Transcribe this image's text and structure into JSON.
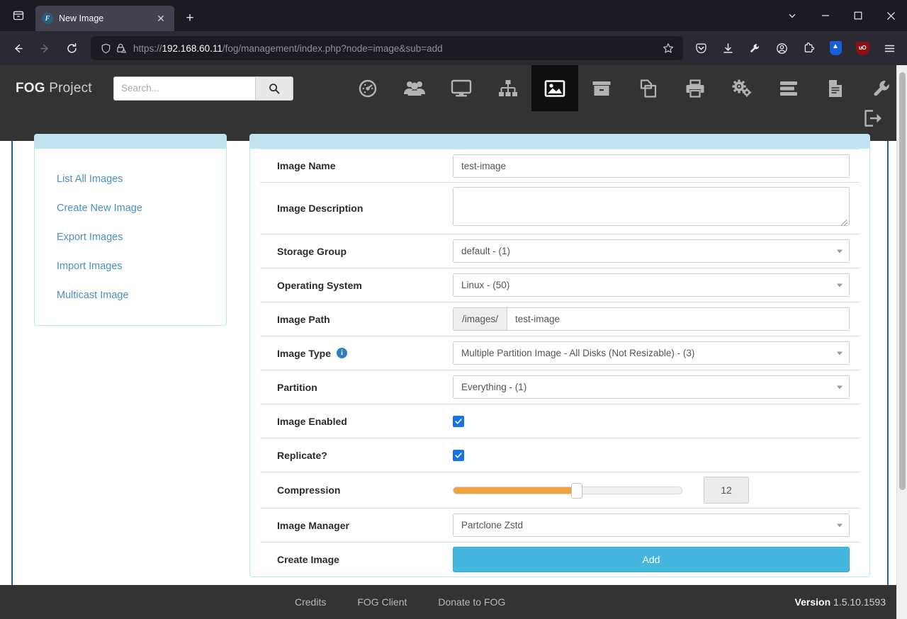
{
  "browser": {
    "tab": {
      "title": "New Image",
      "favicon_letter": "F",
      "close_label": "✕"
    },
    "new_tab_label": "+",
    "firefox_view_icon": "firefox-view-icon",
    "url": {
      "protocol": "https://",
      "domain": "192.168.60.11",
      "path": "/fog/management/index.php?node=image&sub=add"
    },
    "toolbar_icons": [
      "pocket-icon",
      "download-icon",
      "wrench-icon",
      "account-icon",
      "extensions-icon",
      "bitwarden-icon",
      "ublock-origin-icon",
      "app-menu-icon"
    ],
    "ublock_label": "uO",
    "window_controls": [
      "tab-list-chevron",
      "minimize",
      "maximize",
      "close"
    ]
  },
  "header": {
    "brand_bold": "FOG",
    "brand_rest": " Project",
    "search": {
      "placeholder": "Search...",
      "value": ""
    },
    "nav": [
      {
        "name": "dashboard",
        "icon": "gauge-icon",
        "active": false
      },
      {
        "name": "users",
        "icon": "users-icon",
        "active": false
      },
      {
        "name": "hosts",
        "icon": "monitor-icon",
        "active": false
      },
      {
        "name": "groups",
        "icon": "sitemap-icon",
        "active": false
      },
      {
        "name": "images",
        "icon": "picture-icon",
        "active": true
      },
      {
        "name": "snapins",
        "icon": "archive-box-icon",
        "active": false
      },
      {
        "name": "printers-clone",
        "icon": "clone-icon",
        "active": false
      },
      {
        "name": "printers",
        "icon": "printer-icon",
        "active": false
      },
      {
        "name": "services",
        "icon": "cogs-icon",
        "active": false
      },
      {
        "name": "tasks",
        "icon": "tasks-icon",
        "active": false
      },
      {
        "name": "reports",
        "icon": "report-icon",
        "active": false
      },
      {
        "name": "settings",
        "icon": "wrench-icon",
        "active": false
      }
    ],
    "logout_icon": "logout-icon"
  },
  "sidebar": {
    "items": [
      {
        "label": "List All Images"
      },
      {
        "label": "Create New Image"
      },
      {
        "label": "Export Images"
      },
      {
        "label": "Import Images"
      },
      {
        "label": "Multicast Image"
      }
    ]
  },
  "form": {
    "image_name": {
      "label": "Image Name",
      "value": "test-image"
    },
    "image_description": {
      "label": "Image Description",
      "value": ""
    },
    "storage_group": {
      "label": "Storage Group",
      "value": "default - (1)"
    },
    "operating_system": {
      "label": "Operating System",
      "value": "Linux - (50)"
    },
    "image_path": {
      "label": "Image Path",
      "prefix": "/images/",
      "value": "test-image"
    },
    "image_type": {
      "label": "Image Type",
      "info_icon": "info-icon",
      "value": "Multiple Partition Image - All Disks (Not Resizable) - (3)"
    },
    "partition": {
      "label": "Partition",
      "value": "Everything - (1)"
    },
    "image_enabled": {
      "label": "Image Enabled",
      "checked": true
    },
    "replicate": {
      "label": "Replicate?",
      "checked": true
    },
    "compression": {
      "label": "Compression",
      "value": "12",
      "percent": 54
    },
    "image_manager": {
      "label": "Image Manager",
      "value": "Partclone Zstd"
    },
    "create_image": {
      "label": "Create Image",
      "button_label": "Add"
    }
  },
  "footer": {
    "links": [
      "Credits",
      "FOG Client",
      "Donate to FOG"
    ],
    "version_label": "Version",
    "version_value": "1.5.10.1593"
  },
  "colors": {
    "panel_header": "#c3e3f2",
    "accent_blue": "#2a6496",
    "slider_orange": "#f0a33c",
    "add_button": "#45b6dd",
    "checkbox_blue": "#1473e6",
    "header_dark": "#333333"
  }
}
